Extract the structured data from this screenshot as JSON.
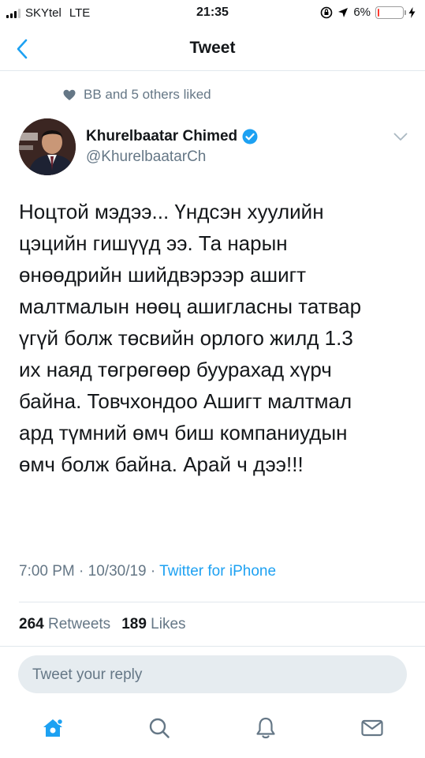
{
  "status_bar": {
    "carrier": "SKYtel",
    "network": "LTE",
    "time": "21:35",
    "battery": "6%",
    "battery_level": 0.06
  },
  "header": {
    "title": "Tweet",
    "back_icon": "chevron-left-icon"
  },
  "social_context": {
    "text": "BB and 5 others liked",
    "icon": "heart-icon"
  },
  "author": {
    "name": "Khurelbaatar Chimed",
    "handle": "@KhurelbaatarCh",
    "verified": true
  },
  "tweet": {
    "lines": [
      "Ноцтой мэдээ... Үндсэн хуулийн",
      "цэцийн гишүүд ээ. Та нарын",
      "өнөөдрийн шийдвэрээр ашигт",
      "малтмалын нөөц ашигласны татвар",
      "үгүй болж төсвийн орлого жилд 1.3",
      "их наяд төгрөгөөр буурахад хүрч",
      "байна. Товчхондоо Ашигт малтмал",
      "ард түмний өмч биш компаниудын",
      "өмч болж байна. Арай ч дээ!!!"
    ],
    "time": "7:00 PM",
    "date": "10/30/19",
    "separator": "·",
    "source": "Twitter for iPhone"
  },
  "stats": {
    "retweets_count": "264",
    "retweets_label": "Retweets",
    "likes_count": "189",
    "likes_label": "Likes"
  },
  "reply": {
    "placeholder": "Tweet your reply"
  },
  "tab_bar": {
    "items": [
      "home-icon",
      "search-icon",
      "notifications-icon",
      "messages-icon"
    ]
  },
  "colors": {
    "accent": "#1da1f2",
    "secondary_text": "#657786",
    "battery_low": "#ff3b30"
  }
}
